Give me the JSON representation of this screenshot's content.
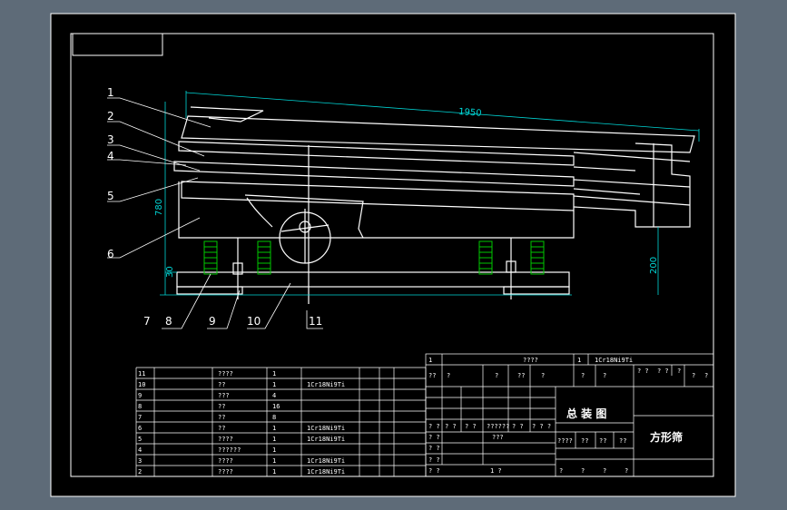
{
  "colors": {
    "background": "#5e6b78",
    "sheet": "#000000",
    "line": "#ffffff",
    "dimension": "#00d6d6",
    "spring": "#00c800"
  },
  "callouts": [
    "1",
    "2",
    "3",
    "4",
    "5",
    "6",
    "7",
    "8",
    "9",
    "10",
    "11"
  ],
  "dimensions": {
    "length": "1950",
    "height": "780",
    "base": "30",
    "right": "200"
  },
  "parts_list": {
    "rows": [
      {
        "no": "11",
        "name": "????",
        "qty": "1",
        "material": ""
      },
      {
        "no": "10",
        "name": "??",
        "qty": "1",
        "material": "1Cr18Ni9Ti"
      },
      {
        "no": "9",
        "name": "???",
        "qty": "4",
        "material": ""
      },
      {
        "no": "8",
        "name": "??",
        "qty": "16",
        "material": ""
      },
      {
        "no": "7",
        "name": "??",
        "qty": "8",
        "material": ""
      },
      {
        "no": "6",
        "name": "??",
        "qty": "1",
        "material": "1Cr18Ni9Ti"
      },
      {
        "no": "5",
        "name": "????",
        "qty": "1",
        "material": "1Cr18Ni9Ti"
      },
      {
        "no": "4",
        "name": "??????",
        "qty": "1",
        "material": ""
      },
      {
        "no": "3",
        "name": "????",
        "qty": "1",
        "material": "1Cr18Ni9Ti"
      },
      {
        "no": "2",
        "name": "????",
        "qty": "1",
        "material": "1Cr18Ni9Ti"
      }
    ]
  },
  "title_block": {
    "top_row": {
      "c1": "1",
      "c2": "????",
      "c3": "1",
      "c4": "1Cr18Ni9Ti"
    },
    "row2": [
      "??",
      "?",
      "?",
      "??",
      "?",
      "?",
      "?"
    ],
    "row2_right": [
      "? ?",
      "? ?",
      "?",
      "?",
      "?"
    ],
    "title": "总 装 图",
    "sign_row": [
      "? ?",
      "? ?",
      "? ?",
      "??????",
      "? ?",
      "? ? ?"
    ],
    "row_a": [
      "? ?",
      "???"
    ],
    "row_b": [
      "????",
      "??",
      "??",
      "??"
    ],
    "row_c": [
      "? ?"
    ],
    "row_d": [
      "? ?",
      "? ?"
    ],
    "row_e": [
      "?",
      "?",
      "?",
      "?"
    ],
    "row_f": [
      "? ?",
      "1 ?"
    ],
    "name": "方形筛"
  }
}
